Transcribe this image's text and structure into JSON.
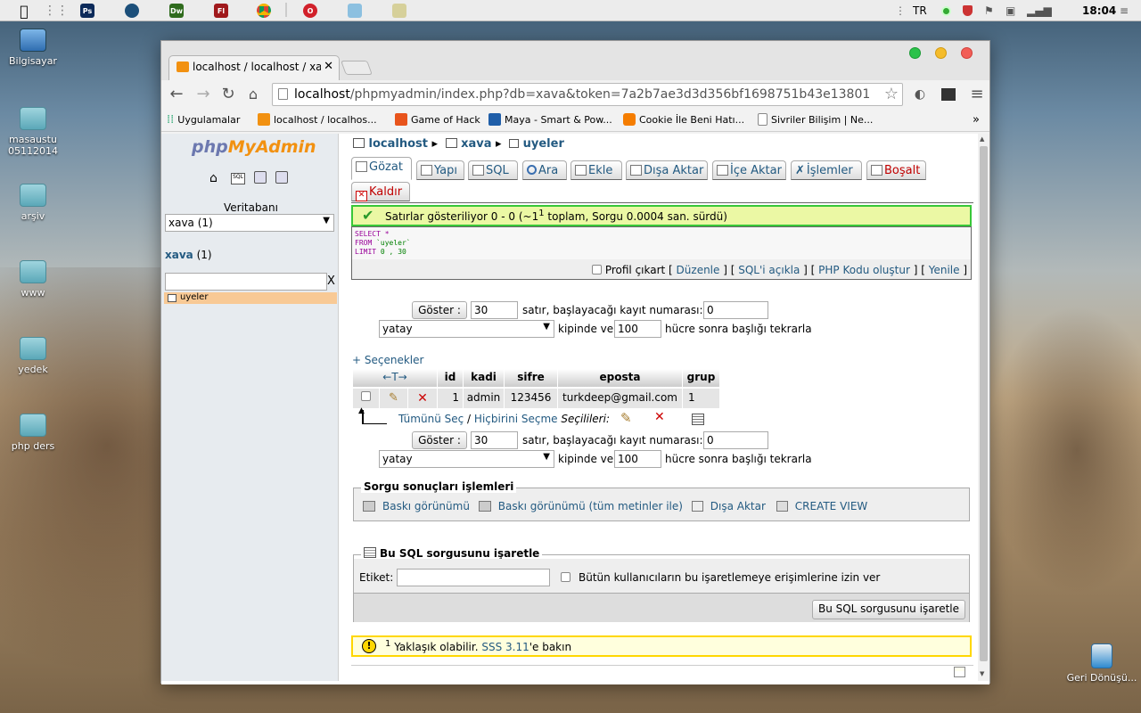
{
  "menubar": {
    "lang": "TR",
    "clock": "18:04",
    "apps": [
      {
        "icon": "ps-icon",
        "label": "Ps",
        "color": "#0c2a5a"
      },
      {
        "icon": "dw-icon",
        "label": "Dw",
        "color": "#2f6b1d"
      },
      {
        "icon": "fl-icon",
        "label": "Fl",
        "color": "#a0191c"
      }
    ]
  },
  "desktop": {
    "icons": [
      "Bilgisayar",
      "masaustu\n05112014",
      "arşiv",
      "www",
      "yedek",
      "php ders"
    ],
    "trash": "Geri Dönüşü..."
  },
  "browser": {
    "tab_title": "localhost / localhost / xa",
    "url_host": "localhost",
    "url_path": "/phpmyadmin/index.php?db=xava&token=7a2b7ae3d3d356bf1698751b43e13801",
    "bookmarks": [
      "Uygulamalar",
      "localhost / localhos...",
      "Game of Hack",
      "Maya - Smart & Pow...",
      "Cookie İle Beni Hatı...",
      "Sivriler Bilişim | Ne..."
    ],
    "more": "»"
  },
  "nav": {
    "logo_php": "php",
    "logo_mya": "MyAdmin",
    "db_label": "Veritabanı",
    "db_select": "xava (1)",
    "db_link": "xava",
    "db_count": "(1)",
    "filter_clear": "X",
    "table": "uyeler"
  },
  "breadcrumb": {
    "server": "localhost",
    "db": "xava",
    "table": "uyeler"
  },
  "tabs": [
    {
      "label": "Gözat",
      "color": "#235a81"
    },
    {
      "label": "Yapı",
      "color": "#235a81"
    },
    {
      "label": "SQL",
      "color": "#235a81"
    },
    {
      "label": "Ara",
      "color": "#235a81"
    },
    {
      "label": "Ekle",
      "color": "#235a81"
    },
    {
      "label": "Dışa Aktar",
      "color": "#235a81"
    },
    {
      "label": "İçe Aktar",
      "color": "#235a81"
    },
    {
      "label": "İşlemler",
      "color": "#235a81"
    },
    {
      "label": "Boşalt",
      "color": "#c00000"
    },
    {
      "label": "Kaldır",
      "color": "#c00000"
    }
  ],
  "success": {
    "pre": "Satırlar gösteriliyor 0 - 0 (~1",
    "sup": "1",
    "post": " toplam, Sorgu 0.0004 san. sürdü)"
  },
  "sql": {
    "line1": "SELECT *",
    "line2_kw": "FROM",
    "line2_val": "`uyeler`",
    "line3_kw": "LIMIT",
    "line3_val": "0 , 30"
  },
  "sql_links": {
    "profile": "Profil çıkart",
    "edit": "Düzenle",
    "explain": "SQL'i açıkla",
    "php": "PHP Kodu oluştur",
    "refresh": "Yenile"
  },
  "pager": {
    "show_button": "Göster :",
    "rows": "30",
    "rows_label": "satır, başlayacağı kayıt numarası:",
    "start": "0",
    "mode": "yatay",
    "mode_label": "kipinde ve",
    "repeat": "100",
    "repeat_label": "hücre sonra başlığı tekrarla"
  },
  "options_link": "+ Seçenekler",
  "table": {
    "arrows": "←T→",
    "headers": [
      "id",
      "kadi",
      "sifre",
      "eposta",
      "grup"
    ],
    "rows": [
      {
        "id": "1",
        "kadi": "admin",
        "sifre": "123456",
        "eposta": "turkdeep@gmail.com",
        "grup": "1"
      }
    ]
  },
  "bulk": {
    "select_all": "Tümünü Seç",
    "sep": "/",
    "select_none": "Hiçbirini Seçme",
    "selected": "Seçilileri:"
  },
  "ops": {
    "legend": "Sorgu sonuçları işlemleri",
    "print": "Baskı görünümü",
    "print_full": "Baskı görünümü (tüm metinler ile)",
    "export": "Dışa Aktar",
    "create_view": "CREATE VIEW"
  },
  "bookmark_sql": {
    "legend": "Bu SQL sorgusunu işaretle",
    "label": "Etiket:",
    "label_value": "",
    "share": "Bütün kullanıcıların bu işaretlemeye erişimlerine izin ver",
    "submit": "Bu SQL sorgusunu işaretle"
  },
  "notice": {
    "sup": "1",
    "text": " Yaklaşık olabilir. ",
    "link": "SSS 3.11",
    "after": "'e bakın"
  }
}
